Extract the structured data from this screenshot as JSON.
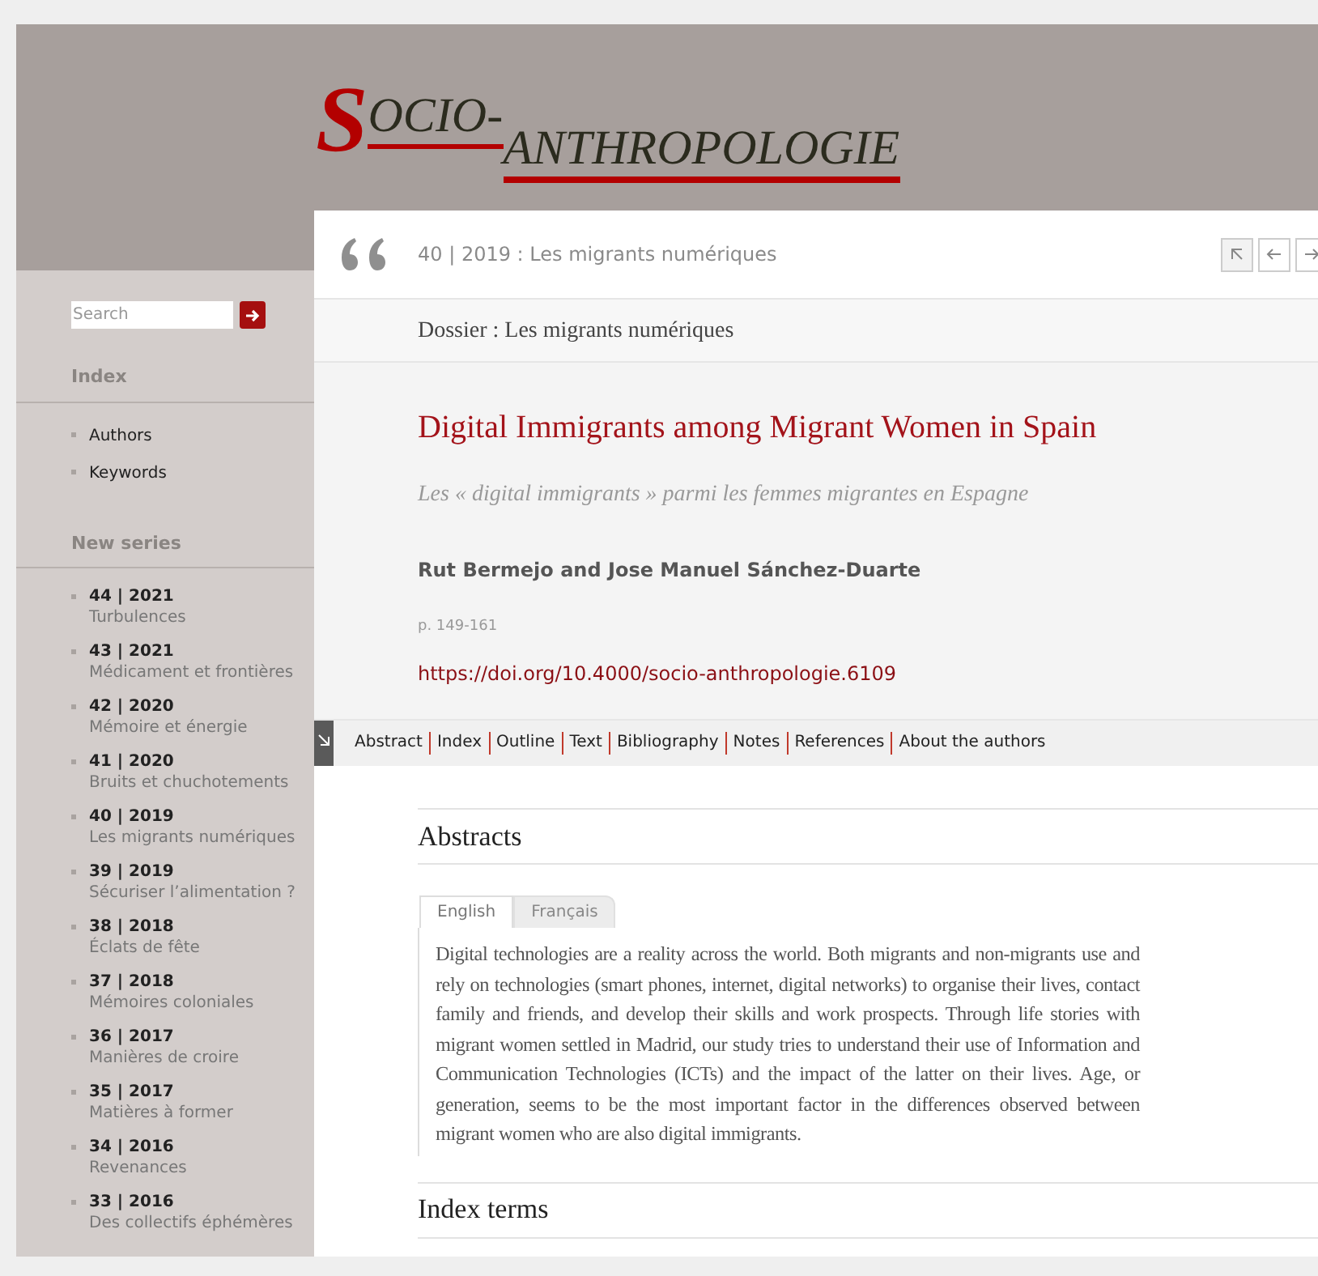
{
  "logo": {
    "initial": "S",
    "first": "OCIO-",
    "second": "ANTHROPOLOGIE"
  },
  "sidebar": {
    "search": {
      "placeholder": "Search"
    },
    "index": {
      "heading": "Index",
      "items": [
        "Authors",
        "Keywords"
      ]
    },
    "series": {
      "heading": "New series",
      "items": [
        {
          "number": "44 | 2021",
          "title": "Turbulences"
        },
        {
          "number": "43 | 2021",
          "title": "Médicament et frontières"
        },
        {
          "number": "42 | 2020",
          "title": "Mémoire et énergie"
        },
        {
          "number": "41 | 2020",
          "title": "Bruits et chuchotements"
        },
        {
          "number": "40 | 2019",
          "title": "Les migrants numériques"
        },
        {
          "number": "39 | 2019",
          "title": "Sécuriser l’alimentation ?"
        },
        {
          "number": "38 | 2018",
          "title": "Éclats de fête"
        },
        {
          "number": "37 | 2018",
          "title": "Mémoires coloniales"
        },
        {
          "number": "36 | 2017",
          "title": "Manières de croire"
        },
        {
          "number": "35 | 2017",
          "title": "Matières à former"
        },
        {
          "number": "34 | 2016",
          "title": "Revenances"
        },
        {
          "number": "33 | 2016",
          "title": "Des collectifs éphémères"
        }
      ]
    }
  },
  "issue": "40 | 2019 : Les migrants numériques",
  "dossier": "Dossier : Les migrants numériques",
  "article": {
    "title": "Digital Immigrants among Migrant Women in Spain",
    "subtitle": "Les « digital immigrants » parmi les femmes migrantes en Espagne",
    "authors": "Rut Bermejo and Jose Manuel Sánchez-Duarte",
    "pages": "p. 149-161",
    "doi": "https://doi.org/10.4000/socio-anthropologie.6109"
  },
  "toc": [
    "Abstract",
    "Index",
    "Outline",
    "Text",
    "Bibliography",
    "Notes",
    "References",
    "About the authors"
  ],
  "abstracts": {
    "heading": "Abstracts",
    "tabs": [
      {
        "label": "English",
        "selected": true
      },
      {
        "label": "Français",
        "selected": false
      }
    ],
    "text": "Digital technologies are a reality across the world. Both migrants and non-migrants use and rely on technologies (smart phones, internet, digital networks) to organise their lives, contact family and friends, and develop their skills and work prospects. Through life stories with migrant women settled in Madrid, our study tries to understand their use of Information and Communication Technologies (ICTs) and the impact of the latter on their lives. Age, or generation, seems to be the most important factor in the differences observed between migrant women who are also digital immigrants."
  },
  "index_terms": {
    "heading": "Index terms"
  }
}
